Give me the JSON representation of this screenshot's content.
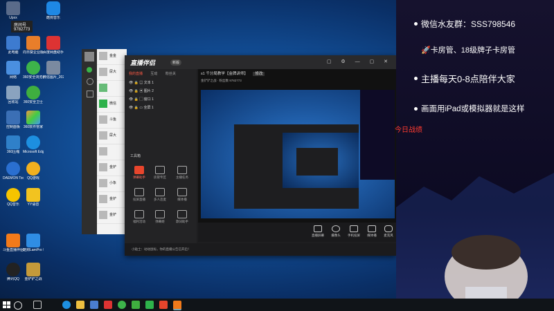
{
  "desktop": {
    "icons": [
      {
        "label": "Upxx"
      },
      {
        "label": "酷狗音乐"
      },
      {
        "label": "此电脑"
      },
      {
        "label": "向日葵企业版"
      },
      {
        "label": "百度网盘助手"
      },
      {
        "label": "网络"
      },
      {
        "label": "360安全浏览器"
      },
      {
        "label": "微信图片_2021091..."
      },
      {
        "label": "回收站"
      },
      {
        "label": "360安全卫士"
      },
      {
        "label": "控制面板"
      },
      {
        "label": "360软件管家"
      },
      {
        "label": "360压缩"
      },
      {
        "label": "Microsoft Edge"
      },
      {
        "label": "DAEMON Tools Lite"
      },
      {
        "label": "QQ游戏"
      },
      {
        "label": "QQ音乐"
      },
      {
        "label": "YY语音"
      },
      {
        "label": "斗鱼直播伴侣"
      },
      {
        "label": "酷狗LamPro 机器"
      },
      {
        "label": "腾讯QQ"
      },
      {
        "label": "金铲铲之战"
      }
    ],
    "room": {
      "label": "房间号",
      "number": "9782773"
    }
  },
  "wechat": {
    "items": [
      {
        "name": "金金"
      },
      {
        "name": "尿大"
      },
      {
        "name": ""
      },
      {
        "name": "微信"
      },
      {
        "name": "斗鱼"
      },
      {
        "name": "尿大"
      },
      {
        "name": ""
      },
      {
        "name": "金铲"
      },
      {
        "name": "小象"
      },
      {
        "name": "金铲"
      },
      {
        "name": "金铲"
      }
    ]
  },
  "app": {
    "logo": "直播伴侣",
    "version": "新版",
    "tabs": [
      "我的直播",
      "互动",
      "粉丝关"
    ],
    "layers": [
      "文本 1",
      "图片 2",
      "窗口 1",
      "全屏 1"
    ],
    "tools_title": "工具箱",
    "tools": [
      {
        "label": "弹幕助手",
        "active": true
      },
      {
        "label": "房管专区",
        "active": false
      },
      {
        "label": "主播任务",
        "active": false
      },
      {
        "label": "投屏直播",
        "active": false
      },
      {
        "label": "多人连麦",
        "active": false
      },
      {
        "label": "媒体播",
        "active": false
      },
      {
        "label": "福利活动",
        "active": false
      },
      {
        "label": "弹幕姬",
        "active": false
      },
      {
        "label": "歌词助手",
        "active": false
      }
    ],
    "stream_title": "s1 千分局教学【金牌讲师】",
    "stream_tag": "修改",
    "stream_meta": "金铲铲之战 · 粉丝数 9782773",
    "controls": [
      {
        "label": "直播屏幕"
      },
      {
        "label": "摄像头"
      },
      {
        "label": "手机投屏"
      },
      {
        "label": "媒体播"
      },
      {
        "label": "麦克风"
      },
      {
        "label": "扬声器"
      }
    ],
    "status_text": "小贴士：动动鼠标，你的直播公告已开启！"
  },
  "overlay": {
    "lines": [
      "微信水友群：SSS798546",
      "卡房管、18级牌子卡房管",
      "主播每天0-8点陪伴大家",
      "画面用iPad或模拟器就是这样"
    ],
    "battle": "今日战绩"
  },
  "colors": {
    "accent": "#e8452c",
    "panel": "#0c0a22"
  }
}
